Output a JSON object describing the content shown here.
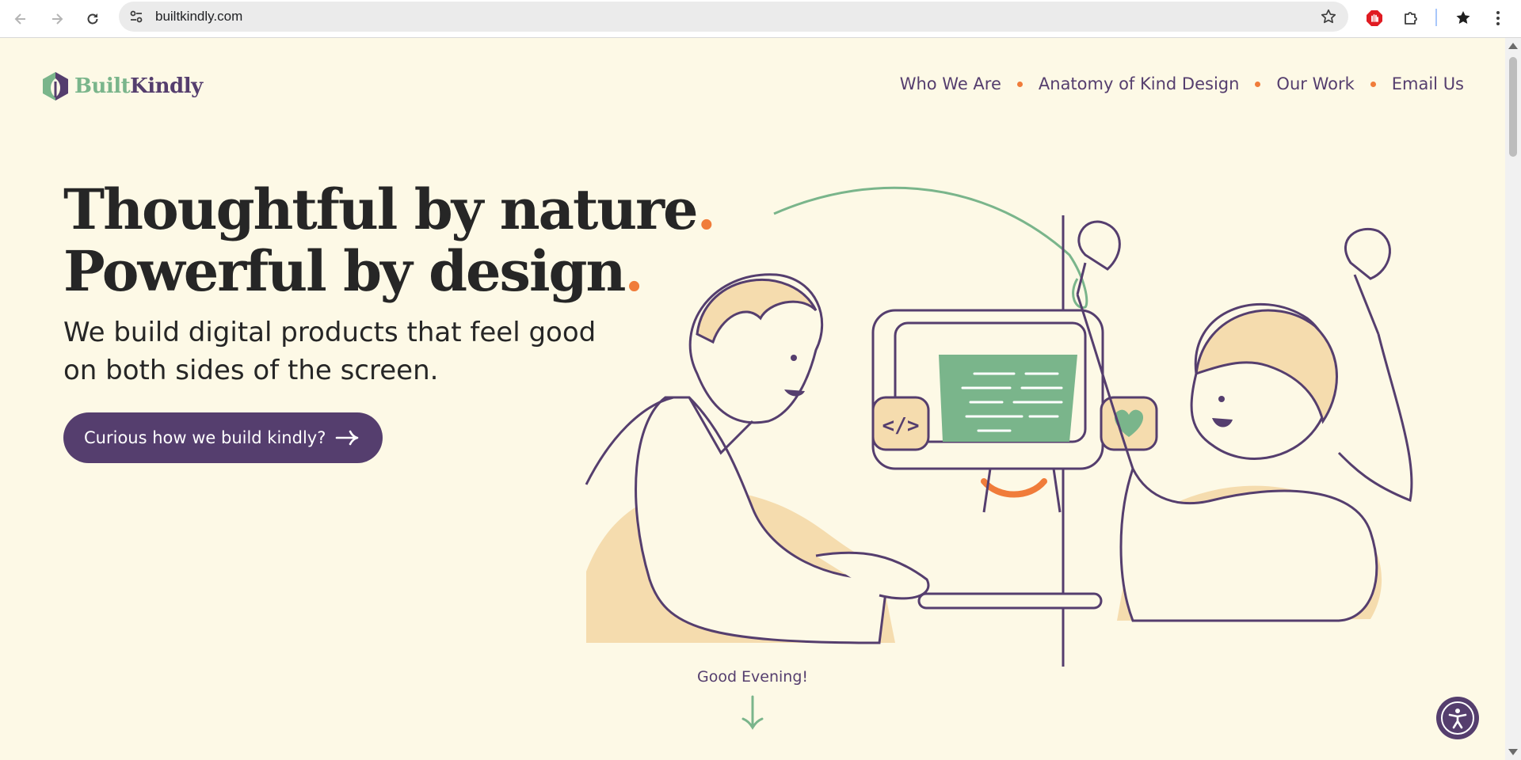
{
  "browser": {
    "url": "builtkindly.com"
  },
  "site": {
    "logo_part1": "Built",
    "logo_part2": "Kindly",
    "nav": [
      "Who We Are",
      "Anatomy of Kind Design",
      "Our Work",
      "Email Us"
    ]
  },
  "hero": {
    "headline_line1": "Thoughtful by nature",
    "headline_line2": "Powerful by design",
    "period": ".",
    "subheadline": "We build digital products that feel good on both sides of the screen.",
    "cta_label": "Curious how we build kindly?"
  },
  "greeting": "Good Evening!",
  "colors": {
    "background": "#fdf9e6",
    "brand_purple": "#553e6e",
    "brand_green": "#7ab58b",
    "accent_orange": "#f07c3a",
    "skin_tan": "#f5dcae"
  },
  "icons": {
    "back": "arrow-left-icon",
    "forward": "arrow-right-icon",
    "reload": "reload-icon",
    "site_info": "tune-icon",
    "bookmark": "star-outline-icon",
    "extensions": "puzzle-icon",
    "accessibility": "accessibility-icon"
  }
}
